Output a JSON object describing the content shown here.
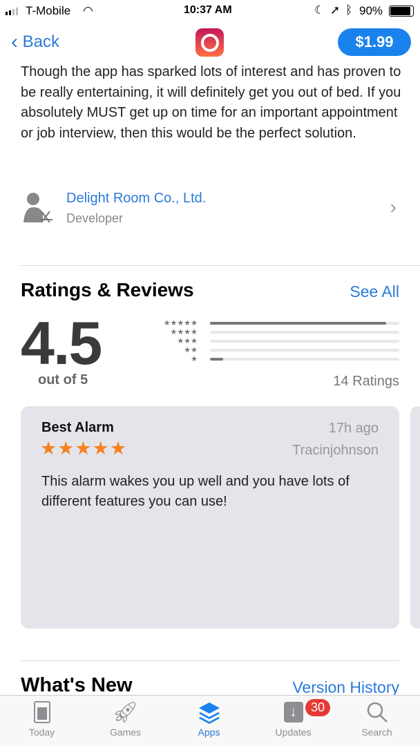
{
  "status": {
    "carrier": "T-Mobile",
    "time": "10:37 AM",
    "battery": "90%"
  },
  "nav": {
    "back": "Back",
    "price": "$1.99"
  },
  "description": "Though the app has sparked lots of interest and has proven to be really entertaining, it will definitely get you out of bed. If you absolutely MUST get up on time for an important appointment or job interview, then this would be the perfect solution.",
  "developer": {
    "name": "Delight Room Co., Ltd.",
    "role": "Developer"
  },
  "ratings": {
    "title": "Ratings & Reviews",
    "see_all": "See All",
    "score": "4.5",
    "out_of": "out of 5",
    "count": "14 Ratings",
    "distribution": [
      {
        "stars": "★★★★★",
        "fraction": 0.93
      },
      {
        "stars": "★★★★",
        "fraction": 0
      },
      {
        "stars": "★★★",
        "fraction": 0
      },
      {
        "stars": "★★",
        "fraction": 0
      },
      {
        "stars": "★",
        "fraction": 0.07
      }
    ]
  },
  "review": {
    "title": "Best Alarm",
    "time": "17h ago",
    "author": "Tracinjohnson",
    "stars": "★★★★★",
    "rating": 5,
    "body": "This alarm wakes you up well and you have lots of different features you can use!"
  },
  "whats_new": {
    "title": "What's New",
    "link": "Version History"
  },
  "tabs": [
    {
      "label": "Today"
    },
    {
      "label": "Games"
    },
    {
      "label": "Apps",
      "active": true
    },
    {
      "label": "Updates",
      "badge": "30"
    },
    {
      "label": "Search"
    }
  ],
  "colors": {
    "accent": "#2a7ad9",
    "star": "#f5821f",
    "badge": "#e53935"
  }
}
